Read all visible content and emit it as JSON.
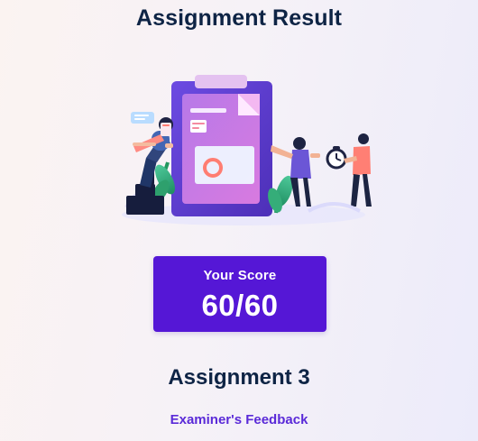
{
  "page": {
    "title": "Assignment Result"
  },
  "score_card": {
    "label": "Your Score",
    "value": "60/60"
  },
  "assignment": {
    "name": "Assignment 3",
    "feedback_link": "Examiner's Feedback"
  },
  "colors": {
    "accent": "#5517d6",
    "heading": "#0e2445",
    "link": "#5a2ad8"
  },
  "icons": {
    "illustration": "assignment-success-illustration"
  }
}
